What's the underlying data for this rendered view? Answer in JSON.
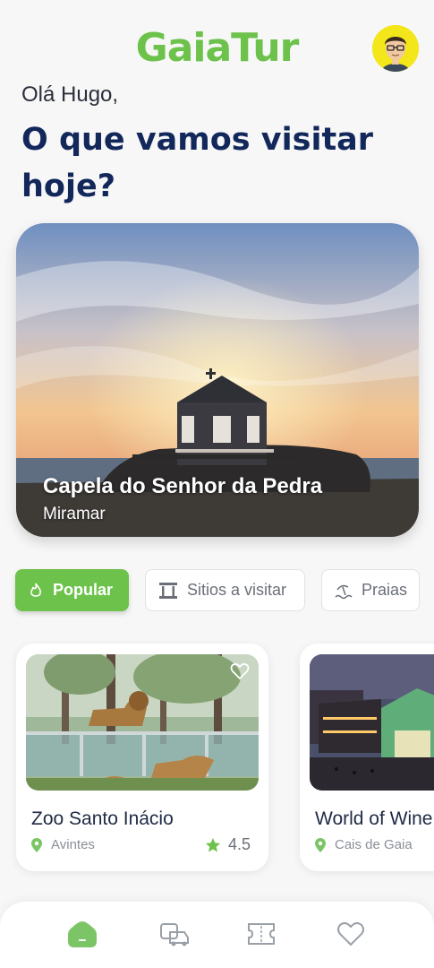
{
  "app": {
    "logo": "GaiaTur"
  },
  "header": {
    "greeting": "Olá Hugo,",
    "headline": "O que vamos visitar hoje?"
  },
  "hero": {
    "title": "Capela do Senhor da Pedra",
    "subtitle": "Miramar"
  },
  "filters": [
    {
      "label": "Popular",
      "icon": "flame-icon",
      "active": true
    },
    {
      "label": "Sitios a visitar",
      "icon": "monument-icon",
      "active": false
    },
    {
      "label": "Praias",
      "icon": "beach-icon",
      "active": false
    }
  ],
  "cards": [
    {
      "title": "Zoo Santo Inácio",
      "location": "Avintes",
      "rating": "4.5"
    },
    {
      "title": "World of Wine",
      "location": "Cais de Gaia"
    }
  ],
  "nav": [
    {
      "icon": "home-icon",
      "active": true
    },
    {
      "icon": "transport-icon",
      "active": false
    },
    {
      "icon": "ticket-icon",
      "active": false
    },
    {
      "icon": "heart-icon",
      "active": false
    }
  ],
  "colors": {
    "brand": "#6cc24a",
    "headline": "#12275a",
    "background": "#f7f7f8"
  }
}
